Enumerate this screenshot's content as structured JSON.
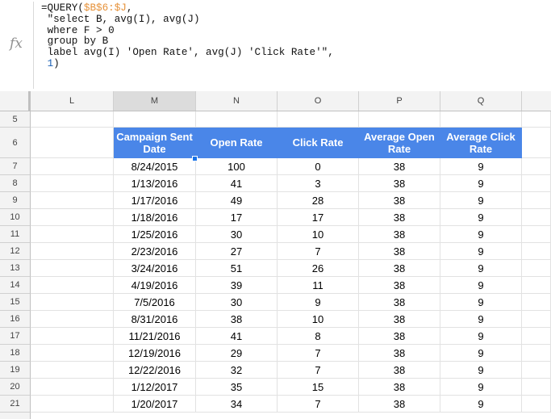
{
  "formula_bar": {
    "fx_label": "fx",
    "line1_prefix": "=QUERY(",
    "line1_ref": "$B$6:$J",
    "line1_suffix": ",",
    "line2": "\"select B, avg(I), avg(J)",
    "line3": "where F > 0",
    "line4": "group by B",
    "line5": "label avg(I) 'Open Rate', avg(J) 'Click Rate'\",",
    "line6_num": "1",
    "line6_suffix": ")"
  },
  "columns": [
    "L",
    "M",
    "N",
    "O",
    "P",
    "Q"
  ],
  "selected_column": "M",
  "row_numbers": [
    "5",
    "6",
    "7",
    "8",
    "9",
    "10",
    "11",
    "12",
    "13",
    "14",
    "15",
    "16",
    "17",
    "18",
    "19",
    "20",
    "21"
  ],
  "table": {
    "headers": [
      "Campaign Sent Date",
      "Open Rate",
      "Click Rate",
      "Average Open Rate",
      "Average Click Rate"
    ],
    "rows": [
      [
        "8/24/2015",
        "100",
        "0",
        "38",
        "9"
      ],
      [
        "1/13/2016",
        "41",
        "3",
        "38",
        "9"
      ],
      [
        "1/17/2016",
        "49",
        "28",
        "38",
        "9"
      ],
      [
        "1/18/2016",
        "17",
        "17",
        "38",
        "9"
      ],
      [
        "1/25/2016",
        "30",
        "10",
        "38",
        "9"
      ],
      [
        "2/23/2016",
        "27",
        "7",
        "38",
        "9"
      ],
      [
        "3/24/2016",
        "51",
        "26",
        "38",
        "9"
      ],
      [
        "4/19/2016",
        "39",
        "11",
        "38",
        "9"
      ],
      [
        "7/5/2016",
        "30",
        "9",
        "38",
        "9"
      ],
      [
        "8/31/2016",
        "38",
        "10",
        "38",
        "9"
      ],
      [
        "11/21/2016",
        "41",
        "8",
        "38",
        "9"
      ],
      [
        "12/19/2016",
        "29",
        "7",
        "38",
        "9"
      ],
      [
        "12/22/2016",
        "32",
        "7",
        "38",
        "9"
      ],
      [
        "1/12/2017",
        "35",
        "15",
        "38",
        "9"
      ],
      [
        "1/20/2017",
        "34",
        "7",
        "38",
        "9"
      ]
    ]
  },
  "colors": {
    "header_bg": "#4a86e8",
    "header_text": "#ffffff",
    "range_ref": "#e69138",
    "number_literal": "#1a5fb4"
  }
}
